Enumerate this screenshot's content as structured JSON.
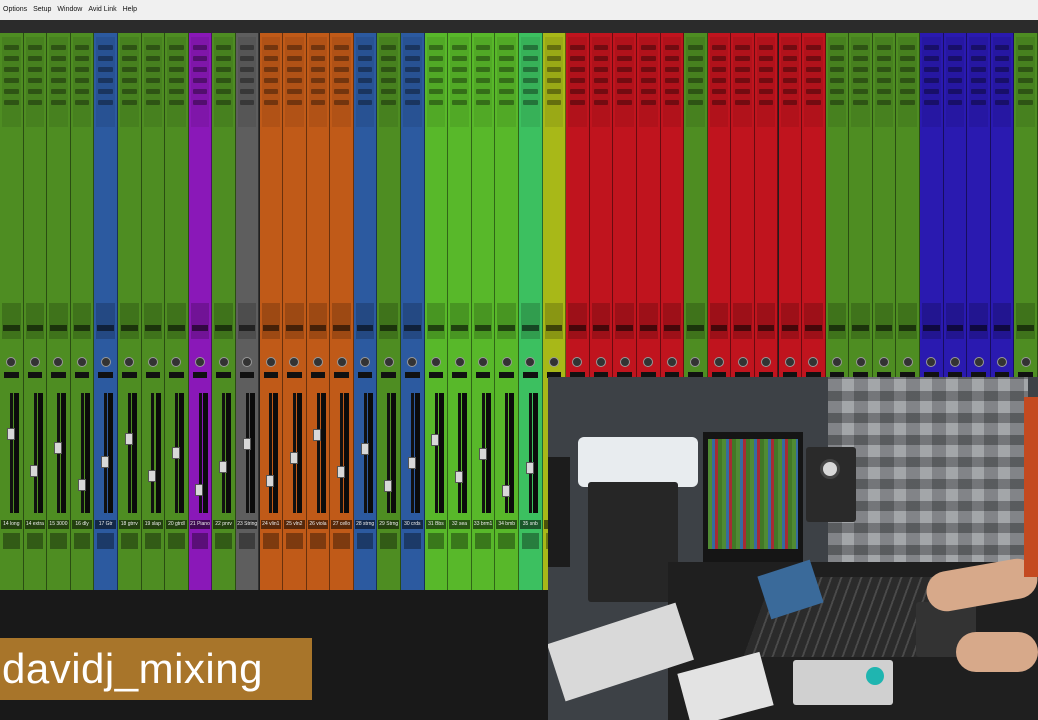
{
  "menubar": {
    "items": [
      "Options",
      "Setup",
      "Window",
      "Avid Link",
      "Help"
    ]
  },
  "mixer": {
    "strips": [
      {
        "color": "#4e8d22",
        "name": "14 long"
      },
      {
        "color": "#4e8d22",
        "name": "14 extra"
      },
      {
        "color": "#4e8d22",
        "name": "15 3000"
      },
      {
        "color": "#4e8d22",
        "name": "16 dly"
      },
      {
        "color": "#2c5aa0",
        "name": "17 Gtr"
      },
      {
        "color": "#4e8d22",
        "name": "18 gtrrv"
      },
      {
        "color": "#4e8d22",
        "name": "19 slap"
      },
      {
        "color": "#4e8d22",
        "name": "20 gtrdl"
      },
      {
        "color": "#8a18b8",
        "name": "21 Piano"
      },
      {
        "color": "#4e8d22",
        "name": "22 pnrv"
      },
      {
        "color": "#5e5e5e",
        "name": "23 String"
      },
      {
        "color": "#c05a18",
        "name": "24 vlin1"
      },
      {
        "color": "#c05a18",
        "name": "25 vln2"
      },
      {
        "color": "#c05a18",
        "name": "26 viola"
      },
      {
        "color": "#c05a18",
        "name": "27 cello"
      },
      {
        "color": "#2c5aa0",
        "name": "28 strng"
      },
      {
        "color": "#4e8d22",
        "name": "29 Strng"
      },
      {
        "color": "#2c5aa0",
        "name": "30 crds"
      },
      {
        "color": "#58b82a",
        "name": "31 Bbs"
      },
      {
        "color": "#58b82a",
        "name": "32 sea"
      },
      {
        "color": "#58b82a",
        "name": "33 brm1"
      },
      {
        "color": "#58b82a",
        "name": "34 bmb"
      },
      {
        "color": "#3cc060",
        "name": "35 snb"
      },
      {
        "color": "#a8b818",
        "name": ""
      },
      {
        "color": "#c0141e",
        "name": ""
      },
      {
        "color": "#c0141e",
        "name": ""
      },
      {
        "color": "#c0141e",
        "name": ""
      },
      {
        "color": "#c0141e",
        "name": ""
      },
      {
        "color": "#c0141e",
        "name": ""
      },
      {
        "color": "#4e8d22",
        "name": ""
      },
      {
        "color": "#c0141e",
        "name": ""
      },
      {
        "color": "#c0141e",
        "name": ""
      },
      {
        "color": "#c0141e",
        "name": ""
      },
      {
        "color": "#c0141e",
        "name": ""
      },
      {
        "color": "#c0141e",
        "name": ""
      },
      {
        "color": "#4e8d22",
        "name": ""
      },
      {
        "color": "#4e8d22",
        "name": ""
      },
      {
        "color": "#4e8d22",
        "name": ""
      },
      {
        "color": "#4e8d22",
        "name": ""
      },
      {
        "color": "#2a1ab0",
        "name": ""
      },
      {
        "color": "#2a1ab0",
        "name": ""
      },
      {
        "color": "#2a1ab0",
        "name": ""
      },
      {
        "color": "#2a1ab0",
        "name": ""
      },
      {
        "color": "#4e8d22",
        "name": ""
      }
    ]
  },
  "watermark": {
    "text": "davidj_mixing",
    "color": "#a8752a"
  },
  "webcam": {
    "description_colors": {
      "wall": "#8c8f93",
      "desk": "#2a2a2a",
      "screen": "#3a6a9a"
    }
  }
}
